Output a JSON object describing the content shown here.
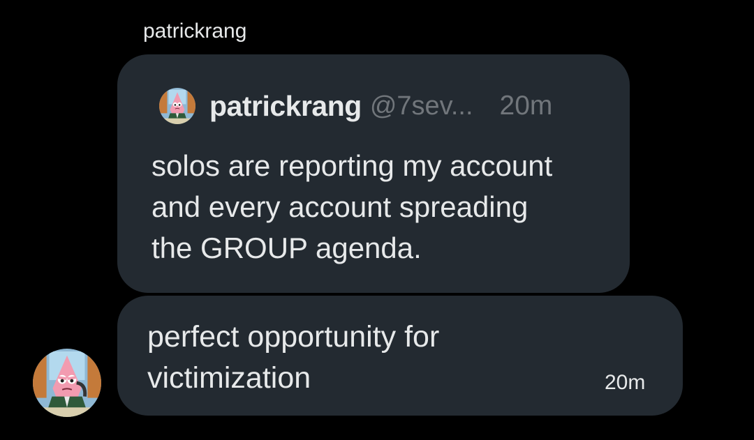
{
  "conversation": {
    "sender_name": "patrickrang"
  },
  "quoted_post": {
    "avatar_icon": "patrick-star-avatar",
    "display_name": "patrickrang",
    "handle": "@7sev...",
    "time": "20m",
    "text": "solos are reporting my account\nand every account spreading\nthe GROUP agenda."
  },
  "message": {
    "text": "perfect opportunity for\nvictimization",
    "time": "20m",
    "avatar_icon": "patrick-star-avatar"
  },
  "colors": {
    "background": "#000000",
    "bubble": "#232a31",
    "primary_text": "#e7e9ea",
    "secondary_text": "#71767b"
  }
}
